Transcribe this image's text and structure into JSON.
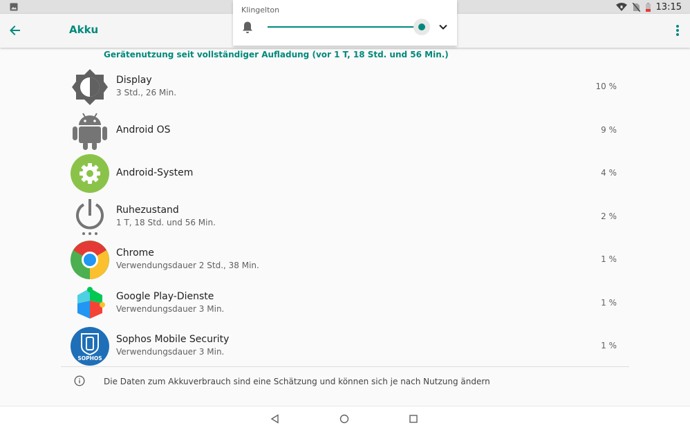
{
  "status_bar": {
    "time": "13:15",
    "icons": [
      "image-icon",
      "wifi-icon",
      "no-sim-icon",
      "battery-low-icon"
    ]
  },
  "app_bar": {
    "title": "Akku",
    "back_icon": "arrow-left-icon",
    "menu_icon": "more-vert-icon"
  },
  "volume_panel": {
    "label": "Klingelton",
    "level": 1.0,
    "icon": "bell-icon",
    "expand_icon": "chevron-down-icon"
  },
  "usage_header": "Gerätenutzung seit vollständiger Aufladung (vor 1 T, 18 Std. und 56 Min.)",
  "items": [
    {
      "name": "Display",
      "detail": "3 Std., 26 Min.",
      "percent": "10 %",
      "icon": "brightness-icon"
    },
    {
      "name": "Android OS",
      "detail": "",
      "percent": "9 %",
      "icon": "android-icon"
    },
    {
      "name": "Android-System",
      "detail": "",
      "percent": "4 %",
      "icon": "android-system-gear-icon"
    },
    {
      "name": "Ruhezustand",
      "detail": "1 T, 18 Std. und 56 Min.",
      "percent": "2 %",
      "icon": "power-standby-icon"
    },
    {
      "name": "Chrome",
      "detail": "Verwendungsdauer 2 Std., 38 Min.",
      "percent": "1 %",
      "icon": "chrome-icon"
    },
    {
      "name": "Google Play-Dienste",
      "detail": "Verwendungsdauer 3 Min.",
      "percent": "1 %",
      "icon": "google-play-services-icon"
    },
    {
      "name": "Sophos Mobile Security",
      "detail": "Verwendungsdauer 3 Min.",
      "percent": "1 %",
      "icon": "sophos-icon",
      "icon_text": "SOPHOS"
    }
  ],
  "footer_info": "Die Daten zum Akkuverbrauch sind eine Schätzung und können sich je nach Nutzung ändern",
  "colors": {
    "accent": "#00897b",
    "status_bar": "#e0e0e0",
    "background": "#fafafa"
  },
  "nav_bar": {
    "icons": [
      "nav-back-icon",
      "nav-home-icon",
      "nav-recents-icon"
    ]
  }
}
